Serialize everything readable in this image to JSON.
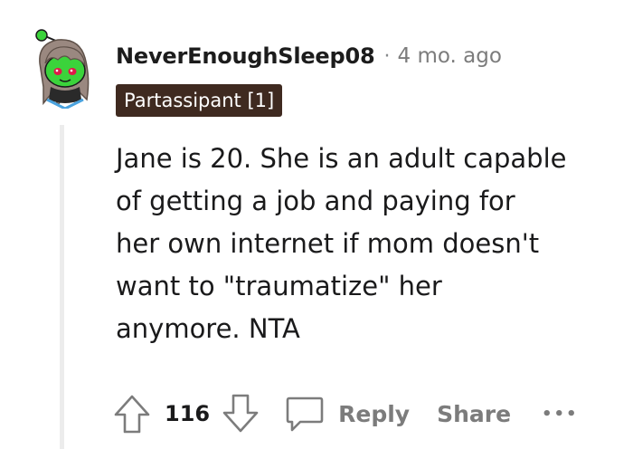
{
  "comment": {
    "username": "NeverEnoughSleep08",
    "separator": "·",
    "timestamp": "4 mo. ago",
    "flair": "Partassipant [1]",
    "body": [
      "Jane is 20. She is an adult capable",
      "of getting a job and paying for",
      "her own internet if mom doesn't",
      "want to \"traumatize\" her",
      "anymore. NTA"
    ],
    "score": "116",
    "reply_label": "Reply",
    "share_label": "Share",
    "more_label": "•••"
  },
  "icons": {
    "avatar": "snoo-avatar-icon",
    "upvote": "upvote-arrow-icon",
    "downvote": "downvote-arrow-icon",
    "reply": "comment-bubble-icon",
    "more": "more-options-icon"
  },
  "colors": {
    "flair_bg": "#3f2a20",
    "flair_text": "#ffffff",
    "muted": "#7c7c7c",
    "thread_line": "#ececec",
    "avatar_green": "#3bd33b",
    "avatar_hair": "#9a8880",
    "avatar_eyes": "#e0184a"
  }
}
